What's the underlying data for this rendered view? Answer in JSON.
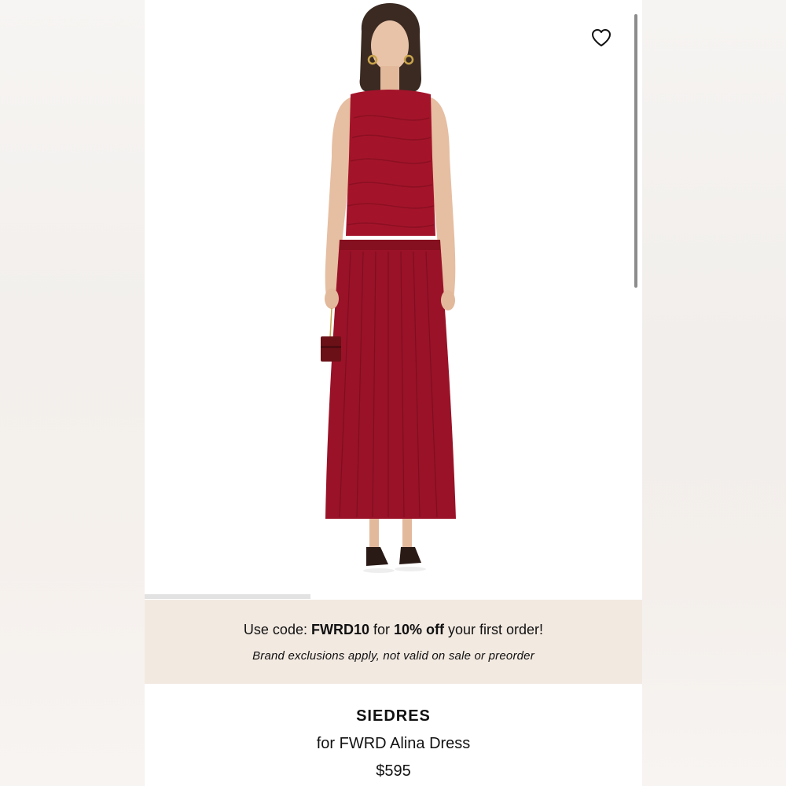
{
  "colors": {
    "dress": "#a3142a",
    "promo_bg": "#f2e9e1",
    "text": "#111111"
  },
  "icons": {
    "wishlist": "heart-outline-icon"
  },
  "gallery": {
    "current_image": 1,
    "image_count": 3,
    "progress_fraction": 0.333
  },
  "promo": {
    "prefix": "Use code: ",
    "code": "FWRD10",
    "middle": " for ",
    "discount": "10% off",
    "suffix": " your first order!",
    "note": "Brand exclusions apply, not valid on sale or preorder"
  },
  "product": {
    "brand": "SIEDRES",
    "name": "for FWRD Alina Dress",
    "price": "$595"
  }
}
